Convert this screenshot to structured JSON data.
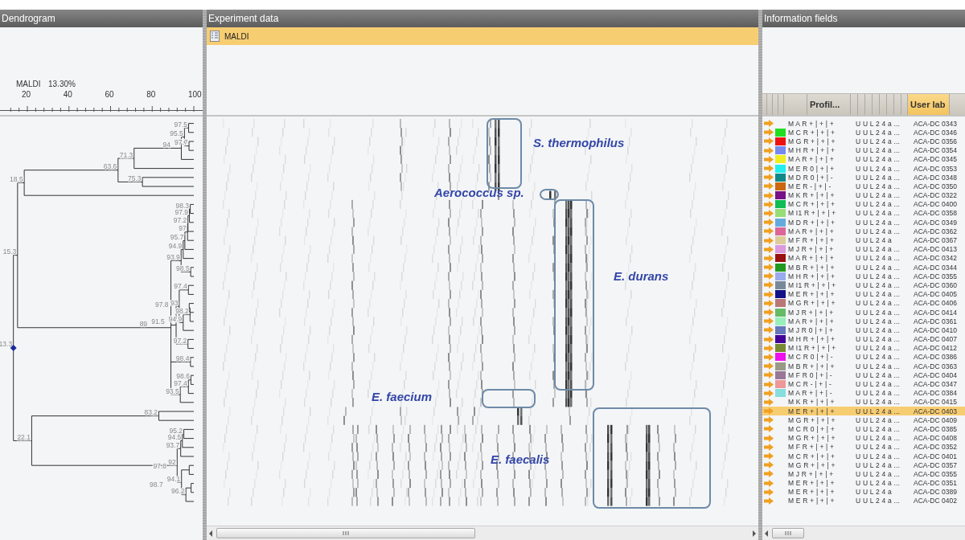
{
  "dendrogram": {
    "title": "Dendrogram",
    "experiment": "MALDI",
    "cutoff": "13.30%",
    "axis_ticks": [
      "20",
      "40",
      "60",
      "80",
      "100"
    ],
    "node_labels": [
      "97.5",
      "95.5",
      "97.7",
      "94",
      "71.3",
      "63.6",
      "75.3",
      "18.5",
      "98.3",
      "97.9",
      "97.2",
      "97",
      "95.7",
      "94.9",
      "15.3",
      "93.9",
      "98.5",
      "97.4",
      "93",
      "97.8",
      "98.2",
      "94.9",
      "91.5",
      "89",
      "97.2",
      "13.3",
      "98.4",
      "98.6",
      "97.4",
      "93.5",
      "83.2",
      "95.2",
      "22.1",
      "94.5",
      "93.7",
      "92",
      "97.8",
      "94.1",
      "98.7",
      "96.2"
    ]
  },
  "experiment_data": {
    "title": "Experiment data",
    "experiments": [
      {
        "label": "MALDI",
        "selected": true
      }
    ],
    "annotations": [
      {
        "label": "S. thermophilus"
      },
      {
        "label": "Aerococcus sp."
      },
      {
        "label": "E. durans"
      },
      {
        "label": "E. faecium"
      },
      {
        "label": "E. faecalis"
      }
    ]
  },
  "information_fields": {
    "title": "Information fields",
    "columns": [
      {
        "label": "Profil...",
        "selected": false
      },
      {
        "label": "User lab",
        "selected": true
      }
    ],
    "rows": [
      {
        "profile": "M A R + | + | +",
        "field": "U U L 2 4 a ...",
        "user_lab": "ACA-DC 0343",
        "selected": false
      },
      {
        "profile": "M C R + | + | +",
        "field": "U U L 2 4 a ...",
        "user_lab": "ACA-DC 0346",
        "selected": false,
        "color": "#22dd22"
      },
      {
        "profile": "M G R + | + | +",
        "field": "U U L 2 4 a ...",
        "user_lab": "ACA-DC 0356",
        "selected": false,
        "color": "#ee1111"
      },
      {
        "profile": "M H R + | + | +",
        "field": "U U L 2 4 a ...",
        "user_lab": "ACA-DC 0354",
        "selected": false,
        "color": "#7788ee"
      },
      {
        "profile": "M A R + | + | +",
        "field": "U U L 2 4 a ...",
        "user_lab": "ACA-DC 0345",
        "selected": false,
        "color": "#eeee22"
      },
      {
        "profile": "M E R 0 | + | +",
        "field": "U U L 2 4 a ...",
        "user_lab": "ACA-DC 0353",
        "selected": false,
        "color": "#22eeee"
      },
      {
        "profile": "M D R 0 | + | -",
        "field": "U U L 2 4 a ...",
        "user_lab": "ACA-DC 0348",
        "selected": false,
        "color": "#118888"
      },
      {
        "profile": "M E R - | + | -",
        "field": "U U L 2 4 a ...",
        "user_lab": "ACA-DC 0350",
        "selected": false,
        "color": "#cc6611"
      },
      {
        "profile": "M K R + | + | +",
        "field": "U U L 2 4 a ...",
        "user_lab": "ACA-DC 0322",
        "selected": false,
        "color": "#771188"
      },
      {
        "profile": "M C R + | + | +",
        "field": "U U L 2 4 a ...",
        "user_lab": "ACA-DC 0400",
        "selected": false,
        "color": "#11bb55"
      },
      {
        "profile": "M I1 R + | + | +",
        "field": "U U L 2 4 a ...",
        "user_lab": "ACA-DC 0358",
        "selected": false,
        "color": "#99dd77"
      },
      {
        "profile": "M D R + | + | +",
        "field": "U U L 2 4 a ...",
        "user_lab": "ACA-DC 0349",
        "selected": false,
        "color": "#66aadd"
      },
      {
        "profile": "M A R + | + | +",
        "field": "U U L 2 4 a ...",
        "user_lab": "ACA-DC 0362",
        "selected": false,
        "color": "#dd6699"
      },
      {
        "profile": "M F R + | + | +",
        "field": "U U L 2 4 a",
        "user_lab": "ACA-DC 0367",
        "selected": false,
        "color": "#ddcc99"
      },
      {
        "profile": "M J R + | + | +",
        "field": "U U L 2 4 a ...",
        "user_lab": "ACA-DC 0413",
        "selected": false,
        "color": "#dd99dd"
      },
      {
        "profile": "M A R + | + | +",
        "field": "U U L 2 4 a ...",
        "user_lab": "ACA-DC 0342",
        "selected": false,
        "color": "#991111"
      },
      {
        "profile": "M B R + | + | +",
        "field": "U U L 2 4 a ...",
        "user_lab": "ACA-DC 0344",
        "selected": false,
        "color": "#229922"
      },
      {
        "profile": "M H R + | + | +",
        "field": "U U L 2 4 a ...",
        "user_lab": "ACA-DC 0355",
        "selected": false,
        "color": "#99aaee"
      },
      {
        "profile": "M I1 R + | + | +",
        "field": "U U L 2 4 a ...",
        "user_lab": "ACA-DC 0360",
        "selected": false,
        "color": "#778899"
      },
      {
        "profile": "M E R + | + | +",
        "field": "U U L 2 4 a ...",
        "user_lab": "ACA-DC 0405",
        "selected": false,
        "color": "#111188"
      },
      {
        "profile": "M G R + | + | +",
        "field": "U U L 2 4 a ...",
        "user_lab": "ACA-DC 0406",
        "selected": false,
        "color": "#bb7777"
      },
      {
        "profile": "M J R + | + | +",
        "field": "U U L 2 4 a ...",
        "user_lab": "ACA-DC 0414",
        "selected": false,
        "color": "#66bb66"
      },
      {
        "profile": "M A R + | + | +",
        "field": "U U L 2 4 a ...",
        "user_lab": "ACA-DC 0361",
        "selected": false,
        "color": "#99eebb"
      },
      {
        "profile": "M J R 0 | + | +",
        "field": "U U L 2 4 a ...",
        "user_lab": "ACA-DC 0410",
        "selected": false,
        "color": "#6677bb"
      },
      {
        "profile": "M H R + | + | +",
        "field": "U U L 2 4 a ...",
        "user_lab": "ACA-DC 0407",
        "selected": false,
        "color": "#440099"
      },
      {
        "profile": "M I1 R + | + | +",
        "field": "U U L 2 4 a ...",
        "user_lab": "ACA-DC 0412",
        "selected": false,
        "color": "#778833"
      },
      {
        "profile": "M C R 0 | + | -",
        "field": "U U L 2 4 a ...",
        "user_lab": "ACA-DC 0386",
        "selected": false,
        "color": "#ee11ee"
      },
      {
        "profile": "M B R + | + | +",
        "field": "U U L 2 4 a ...",
        "user_lab": "ACA-DC 0363",
        "selected": false,
        "color": "#999988"
      },
      {
        "profile": "M F R 0 | + | -",
        "field": "U U L 2 4 a ...",
        "user_lab": "ACA-DC 0404",
        "selected": false,
        "color": "#997799"
      },
      {
        "profile": "M C R - | + | -",
        "field": "U U L 2 4 a ...",
        "user_lab": "ACA-DC 0347",
        "selected": false,
        "color": "#ee9999"
      },
      {
        "profile": "M A R + | + | -",
        "field": "U U L 2 4 a ...",
        "user_lab": "ACA-DC 0384",
        "selected": false,
        "color": "#88dddd"
      },
      {
        "profile": "M K R + | + | +",
        "field": "U U L 2 4 a ...",
        "user_lab": "ACA-DC 0415",
        "selected": false
      },
      {
        "profile": "M E R + | + | +",
        "field": "U U L 2 4 a ...",
        "user_lab": "ACA-DC 0403",
        "selected": true
      },
      {
        "profile": "M G R + | + | +",
        "field": "U U L 2 4 a ...",
        "user_lab": "ACA-DC 0409",
        "selected": false
      },
      {
        "profile": "M C R 0 | + | +",
        "field": "U U L 2 4 a ...",
        "user_lab": "ACA-DC 0385",
        "selected": false
      },
      {
        "profile": "M G R + | + | +",
        "field": "U U L 2 4 a ...",
        "user_lab": "ACA-DC 0408",
        "selected": false
      },
      {
        "profile": "M F R + | + | +",
        "field": "U U L 2 4 a ...",
        "user_lab": "ACA-DC 0352",
        "selected": false
      },
      {
        "profile": "M C R + | + | +",
        "field": "U U L 2 4 a ...",
        "user_lab": "ACA-DC 0401",
        "selected": false
      },
      {
        "profile": "M G R + | + | +",
        "field": "U U L 2 4 a ...",
        "user_lab": "ACA-DC 0357",
        "selected": false
      },
      {
        "profile": "M J R + | + | +",
        "field": "U U L 2 4 a ...",
        "user_lab": "ACA-DC 0355",
        "selected": false
      },
      {
        "profile": "M E R + | + | +",
        "field": "U U L 2 4 a ...",
        "user_lab": "ACA-DC 0351",
        "selected": false
      },
      {
        "profile": "M E R + | + | +",
        "field": "U U L 2 4 a",
        "user_lab": "ACA-DC 0389",
        "selected": false
      },
      {
        "profile": "M E R + | + | +",
        "field": "U U L 2 4 a ...",
        "user_lab": "ACA-DC 0402",
        "selected": false
      }
    ]
  }
}
